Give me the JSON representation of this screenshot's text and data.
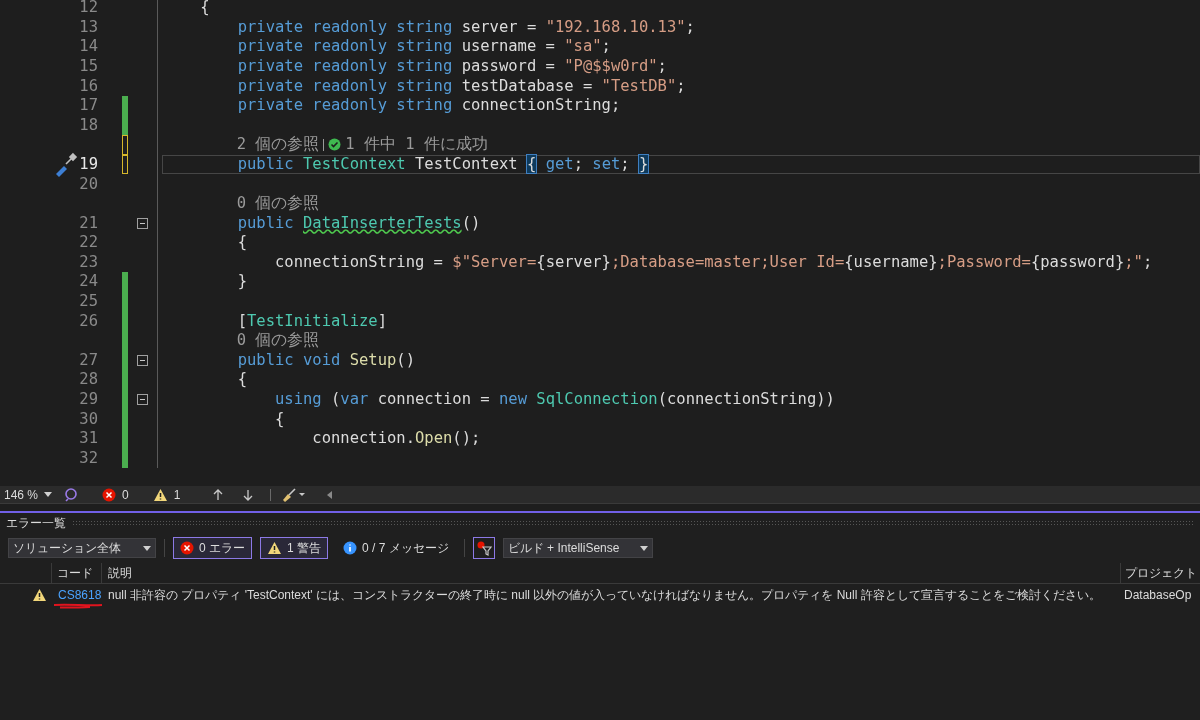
{
  "editor": {
    "lines": [
      {
        "kind": "code",
        "number": "12",
        "changed": false,
        "fold": false,
        "current": false,
        "quick_action": false,
        "tokens": [
          {
            "kind": "plain",
            "text": "    {"
          }
        ]
      },
      {
        "kind": "code",
        "number": "13",
        "changed": false,
        "fold": false,
        "current": false,
        "quick_action": false,
        "tokens": [
          {
            "kind": "keyword",
            "text": "        private readonly string "
          },
          {
            "kind": "plain",
            "text": "server = "
          },
          {
            "kind": "string",
            "text": "\"192.168.10.13\""
          },
          {
            "kind": "plain",
            "text": ";"
          }
        ]
      },
      {
        "kind": "code",
        "number": "14",
        "changed": false,
        "fold": false,
        "current": false,
        "quick_action": false,
        "tokens": [
          {
            "kind": "keyword",
            "text": "        private readonly string "
          },
          {
            "kind": "plain",
            "text": "username = "
          },
          {
            "kind": "string",
            "text": "\"sa\""
          },
          {
            "kind": "plain",
            "text": ";"
          }
        ]
      },
      {
        "kind": "code",
        "number": "15",
        "changed": false,
        "fold": false,
        "current": false,
        "quick_action": false,
        "tokens": [
          {
            "kind": "keyword",
            "text": "        private readonly string "
          },
          {
            "kind": "plain",
            "text": "password = "
          },
          {
            "kind": "string",
            "text": "\"P@$$w0rd\""
          },
          {
            "kind": "plain",
            "text": ";"
          }
        ]
      },
      {
        "kind": "code",
        "number": "16",
        "changed": false,
        "fold": false,
        "current": false,
        "quick_action": false,
        "tokens": [
          {
            "kind": "keyword",
            "text": "        private readonly string "
          },
          {
            "kind": "plain",
            "text": "testDatabase = "
          },
          {
            "kind": "string",
            "text": "\"TestDB\""
          },
          {
            "kind": "plain",
            "text": ";"
          }
        ]
      },
      {
        "kind": "code",
        "number": "17",
        "changed": true,
        "saved": true,
        "fold": false,
        "current": false,
        "quick_action": false,
        "tokens": [
          {
            "kind": "keyword",
            "text": "        private readonly string "
          },
          {
            "kind": "plain",
            "text": "connectionString;"
          }
        ]
      },
      {
        "kind": "code",
        "number": "18",
        "changed": true,
        "saved": true,
        "fold": false,
        "current": false,
        "quick_action": false
      },
      {
        "kind": "lens",
        "changed": true,
        "saved": false,
        "refs": "        2 個の参照",
        "tests": "1 件中 1 件に成功"
      },
      {
        "kind": "code",
        "number": "19",
        "changed": true,
        "saved": false,
        "fold": false,
        "current": true,
        "quick_action": true,
        "tokens": [
          {
            "kind": "keyword",
            "text": "        public "
          },
          {
            "kind": "type",
            "text": "TestContext"
          },
          {
            "kind": "plain",
            "text": " TestContext "
          },
          {
            "kind": "brace_match",
            "text": "{"
          },
          {
            "kind": "keyword",
            "text": " get"
          },
          {
            "kind": "plain",
            "text": "; "
          },
          {
            "kind": "keyword",
            "text": "set"
          },
          {
            "kind": "plain",
            "text": "; "
          },
          {
            "kind": "brace_match",
            "text": "}"
          }
        ]
      },
      {
        "kind": "code",
        "number": "20",
        "changed": false,
        "fold": false,
        "current": false,
        "quick_action": false
      },
      {
        "kind": "lens",
        "changed": false,
        "refs": "        0 個の参照"
      },
      {
        "kind": "code",
        "number": "21",
        "changed": false,
        "fold": true,
        "current": false,
        "quick_action": false,
        "tokens": [
          {
            "kind": "keyword",
            "text": "        public "
          },
          {
            "kind": "warned_type",
            "text": "DataInserterTests"
          },
          {
            "kind": "plain",
            "text": "()"
          }
        ]
      },
      {
        "kind": "code",
        "number": "22",
        "changed": false,
        "fold": false,
        "current": false,
        "quick_action": false,
        "tokens": [
          {
            "kind": "plain",
            "text": "        {"
          }
        ]
      },
      {
        "kind": "code",
        "number": "23",
        "changed": false,
        "fold": false,
        "current": false,
        "quick_action": false,
        "tokens": [
          {
            "kind": "plain",
            "text": "            connectionString = "
          },
          {
            "kind": "string",
            "text": "$\"Server="
          },
          {
            "kind": "plain",
            "text": "{server}"
          },
          {
            "kind": "string",
            "text": ";Database=master;User Id="
          },
          {
            "kind": "plain",
            "text": "{username}"
          },
          {
            "kind": "string",
            "text": ";Password="
          },
          {
            "kind": "plain",
            "text": "{password}"
          },
          {
            "kind": "string",
            "text": ";\""
          },
          {
            "kind": "plain",
            "text": ";"
          }
        ]
      },
      {
        "kind": "code",
        "number": "24",
        "changed": true,
        "saved": true,
        "fold": false,
        "current": false,
        "quick_action": false,
        "tokens": [
          {
            "kind": "plain",
            "text": "        }"
          }
        ]
      },
      {
        "kind": "code",
        "number": "25",
        "changed": true,
        "saved": true,
        "fold": false,
        "current": false,
        "quick_action": false
      },
      {
        "kind": "code",
        "number": "26",
        "changed": true,
        "saved": true,
        "fold": false,
        "current": false,
        "quick_action": false,
        "tokens": [
          {
            "kind": "plain",
            "text": "        ["
          },
          {
            "kind": "type",
            "text": "TestInitialize"
          },
          {
            "kind": "plain",
            "text": "]"
          }
        ]
      },
      {
        "kind": "lens",
        "changed": true,
        "saved": true,
        "refs": "        0 個の参照"
      },
      {
        "kind": "code",
        "number": "27",
        "changed": true,
        "saved": true,
        "fold": true,
        "current": false,
        "quick_action": false,
        "tokens": [
          {
            "kind": "keyword",
            "text": "        public void "
          },
          {
            "kind": "method",
            "text": "Setup"
          },
          {
            "kind": "plain",
            "text": "()"
          }
        ]
      },
      {
        "kind": "code",
        "number": "28",
        "changed": true,
        "saved": true,
        "fold": false,
        "current": false,
        "quick_action": false,
        "tokens": [
          {
            "kind": "plain",
            "text": "        {"
          }
        ]
      },
      {
        "kind": "code",
        "number": "29",
        "changed": true,
        "saved": true,
        "fold": true,
        "current": false,
        "quick_action": false,
        "tokens": [
          {
            "kind": "keyword",
            "text": "            using"
          },
          {
            "kind": "plain",
            "text": " ("
          },
          {
            "kind": "keyword",
            "text": "var"
          },
          {
            "kind": "plain",
            "text": " connection = "
          },
          {
            "kind": "keyword",
            "text": "new "
          },
          {
            "kind": "type",
            "text": "SqlConnection"
          },
          {
            "kind": "plain",
            "text": "(connectionString))"
          }
        ]
      },
      {
        "kind": "code",
        "number": "30",
        "changed": true,
        "saved": true,
        "fold": false,
        "current": false,
        "quick_action": false,
        "tokens": [
          {
            "kind": "plain",
            "text": "            {"
          }
        ]
      },
      {
        "kind": "code",
        "number": "31",
        "changed": true,
        "saved": true,
        "fold": false,
        "current": false,
        "quick_action": false,
        "tokens": [
          {
            "kind": "plain",
            "text": "                connection."
          },
          {
            "kind": "method",
            "text": "Open"
          },
          {
            "kind": "plain",
            "text": "();"
          }
        ]
      },
      {
        "kind": "code",
        "number": "32",
        "changed": true,
        "saved": true,
        "fold": false,
        "current": false,
        "quick_action": false
      }
    ]
  },
  "status_strip": {
    "zoom": "146 %",
    "errors": "0",
    "warnings": "1"
  },
  "error_list": {
    "title": "エラー一覧",
    "scope": "ソリューション全体",
    "filters": [
      {
        "kind": "error",
        "label": "0 エラー",
        "selected": true
      },
      {
        "kind": "warning",
        "label": "1 警告",
        "selected": true
      },
      {
        "kind": "info",
        "label": "0 / 7 メッセージ",
        "selected": false
      }
    ],
    "filter_toggle": {
      "selected": true
    },
    "source": "ビルド + IntelliSense",
    "columns": [
      "コード",
      "説明",
      "プロジェクト"
    ],
    "rows": [
      {
        "kind": "warning",
        "code": "CS8618",
        "description": "null 非許容の プロパティ 'TestContext' には、コンストラクターの終了時に null 以外の値が入っていなければなりません。プロパティを Null 許容として宣言することをご検討ください。",
        "project": "DatabaseOp",
        "annotated": true
      }
    ]
  }
}
